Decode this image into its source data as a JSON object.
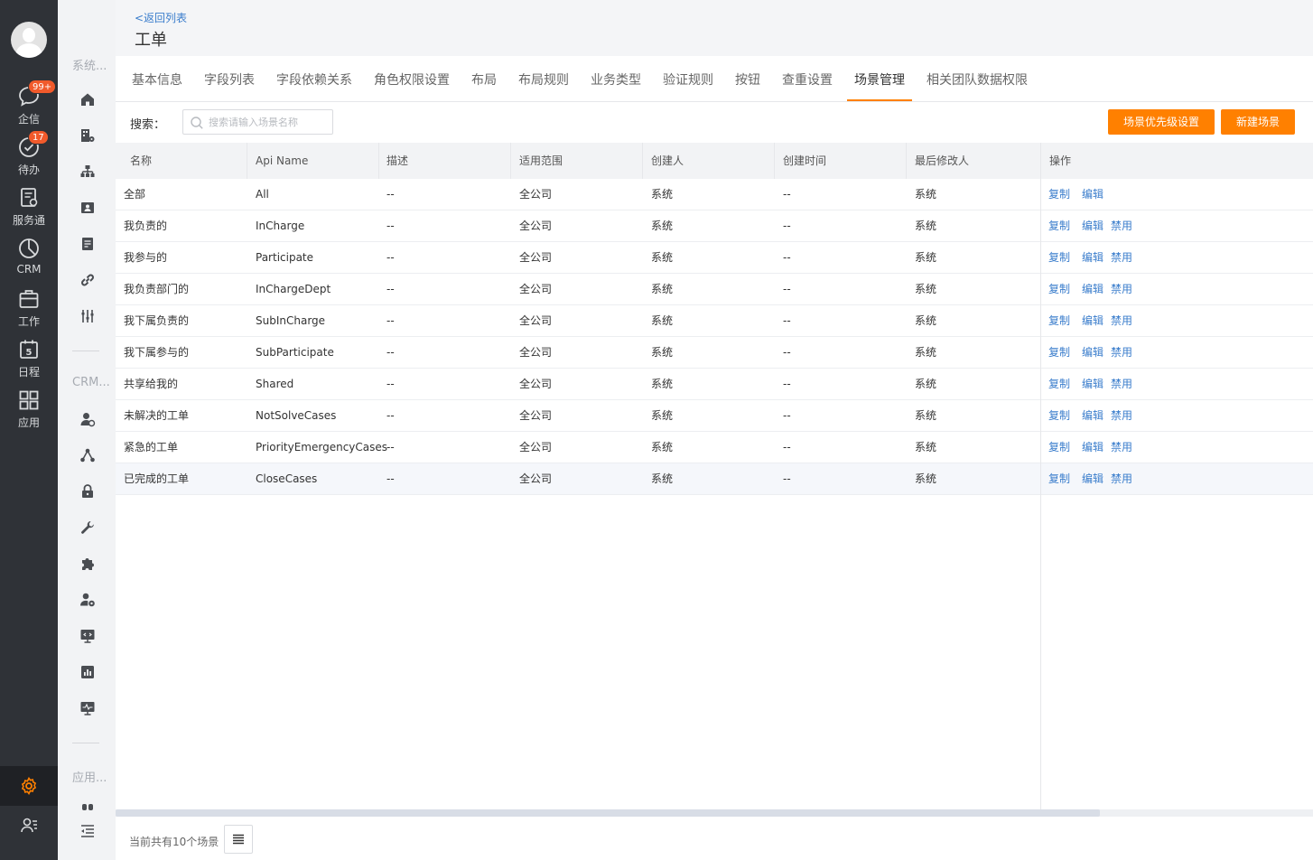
{
  "leftnav": {
    "items": [
      {
        "label": "企信",
        "icon": "chat-bubble-icon",
        "badge": "99+"
      },
      {
        "label": "待办",
        "icon": "check-circle-icon",
        "badge": "17"
      },
      {
        "label": "服务通",
        "icon": "service-icon",
        "badge": ""
      },
      {
        "label": "CRM",
        "icon": "pie-chart-icon",
        "badge": ""
      },
      {
        "label": "工作",
        "icon": "briefcase-icon",
        "badge": ""
      },
      {
        "label": "日程",
        "icon": "calendar-icon",
        "badge": "",
        "calendar_day": "5"
      },
      {
        "label": "应用",
        "icon": "apps-grid-icon",
        "badge": ""
      }
    ],
    "accent_color": "#ff8000"
  },
  "sidebar": {
    "sections": [
      "系统...",
      "CRM...",
      "应用..."
    ]
  },
  "header": {
    "back_link": "<返回列表",
    "title": "工单"
  },
  "tabs": [
    {
      "label": "基本信息",
      "active": false
    },
    {
      "label": "字段列表",
      "active": false
    },
    {
      "label": "字段依赖关系",
      "active": false
    },
    {
      "label": "角色权限设置",
      "active": false
    },
    {
      "label": "布局",
      "active": false
    },
    {
      "label": "布局规则",
      "active": false
    },
    {
      "label": "业务类型",
      "active": false
    },
    {
      "label": "验证规则",
      "active": false
    },
    {
      "label": "按钮",
      "active": false
    },
    {
      "label": "查重设置",
      "active": false
    },
    {
      "label": "场景管理",
      "active": true
    },
    {
      "label": "相关团队数据权限",
      "active": false
    }
  ],
  "toolbar": {
    "search_label": "搜索：",
    "search_placeholder": "搜索请输入场景名称",
    "priority_button": "场景优先级设置",
    "new_button": "新建场景"
  },
  "table": {
    "columns": [
      "名称",
      "Api Name",
      "描述",
      "适用范围",
      "创建人",
      "创建时间",
      "最后修改人",
      "操作"
    ],
    "rows": [
      {
        "name": "全部",
        "api": "All",
        "desc": "--",
        "scope": "全公司",
        "creator": "系统",
        "created": "--",
        "modifier": "系统",
        "actions": [
          "复制",
          "编辑"
        ]
      },
      {
        "name": "我负责的",
        "api": "InCharge",
        "desc": "--",
        "scope": "全公司",
        "creator": "系统",
        "created": "--",
        "modifier": "系统",
        "actions": [
          "复制",
          "编辑",
          "禁用"
        ]
      },
      {
        "name": "我参与的",
        "api": "Participate",
        "desc": "--",
        "scope": "全公司",
        "creator": "系统",
        "created": "--",
        "modifier": "系统",
        "actions": [
          "复制",
          "编辑",
          "禁用"
        ]
      },
      {
        "name": "我负责部门的",
        "api": "InChargeDept",
        "desc": "--",
        "scope": "全公司",
        "creator": "系统",
        "created": "--",
        "modifier": "系统",
        "actions": [
          "复制",
          "编辑",
          "禁用"
        ]
      },
      {
        "name": "我下属负责的",
        "api": "SubInCharge",
        "desc": "--",
        "scope": "全公司",
        "creator": "系统",
        "created": "--",
        "modifier": "系统",
        "actions": [
          "复制",
          "编辑",
          "禁用"
        ]
      },
      {
        "name": "我下属参与的",
        "api": "SubParticipate",
        "desc": "--",
        "scope": "全公司",
        "creator": "系统",
        "created": "--",
        "modifier": "系统",
        "actions": [
          "复制",
          "编辑",
          "禁用"
        ]
      },
      {
        "name": "共享给我的",
        "api": "Shared",
        "desc": "--",
        "scope": "全公司",
        "creator": "系统",
        "created": "--",
        "modifier": "系统",
        "actions": [
          "复制",
          "编辑",
          "禁用"
        ]
      },
      {
        "name": "未解决的工单",
        "api": "NotSolveCases",
        "desc": "--",
        "scope": "全公司",
        "creator": "系统",
        "created": "--",
        "modifier": "系统",
        "actions": [
          "复制",
          "编辑",
          "禁用"
        ]
      },
      {
        "name": "紧急的工单",
        "api": "PriorityEmergencyCases",
        "desc": "--",
        "scope": "全公司",
        "creator": "系统",
        "created": "--",
        "modifier": "系统",
        "actions": [
          "复制",
          "编辑",
          "禁用"
        ]
      },
      {
        "name": "已完成的工单",
        "api": "CloseCases",
        "desc": "--",
        "scope": "全公司",
        "creator": "系统",
        "created": "--",
        "modifier": "系统",
        "actions": [
          "复制",
          "编辑",
          "禁用"
        ]
      }
    ]
  },
  "footer": {
    "summary": "当前共有10个场景"
  }
}
